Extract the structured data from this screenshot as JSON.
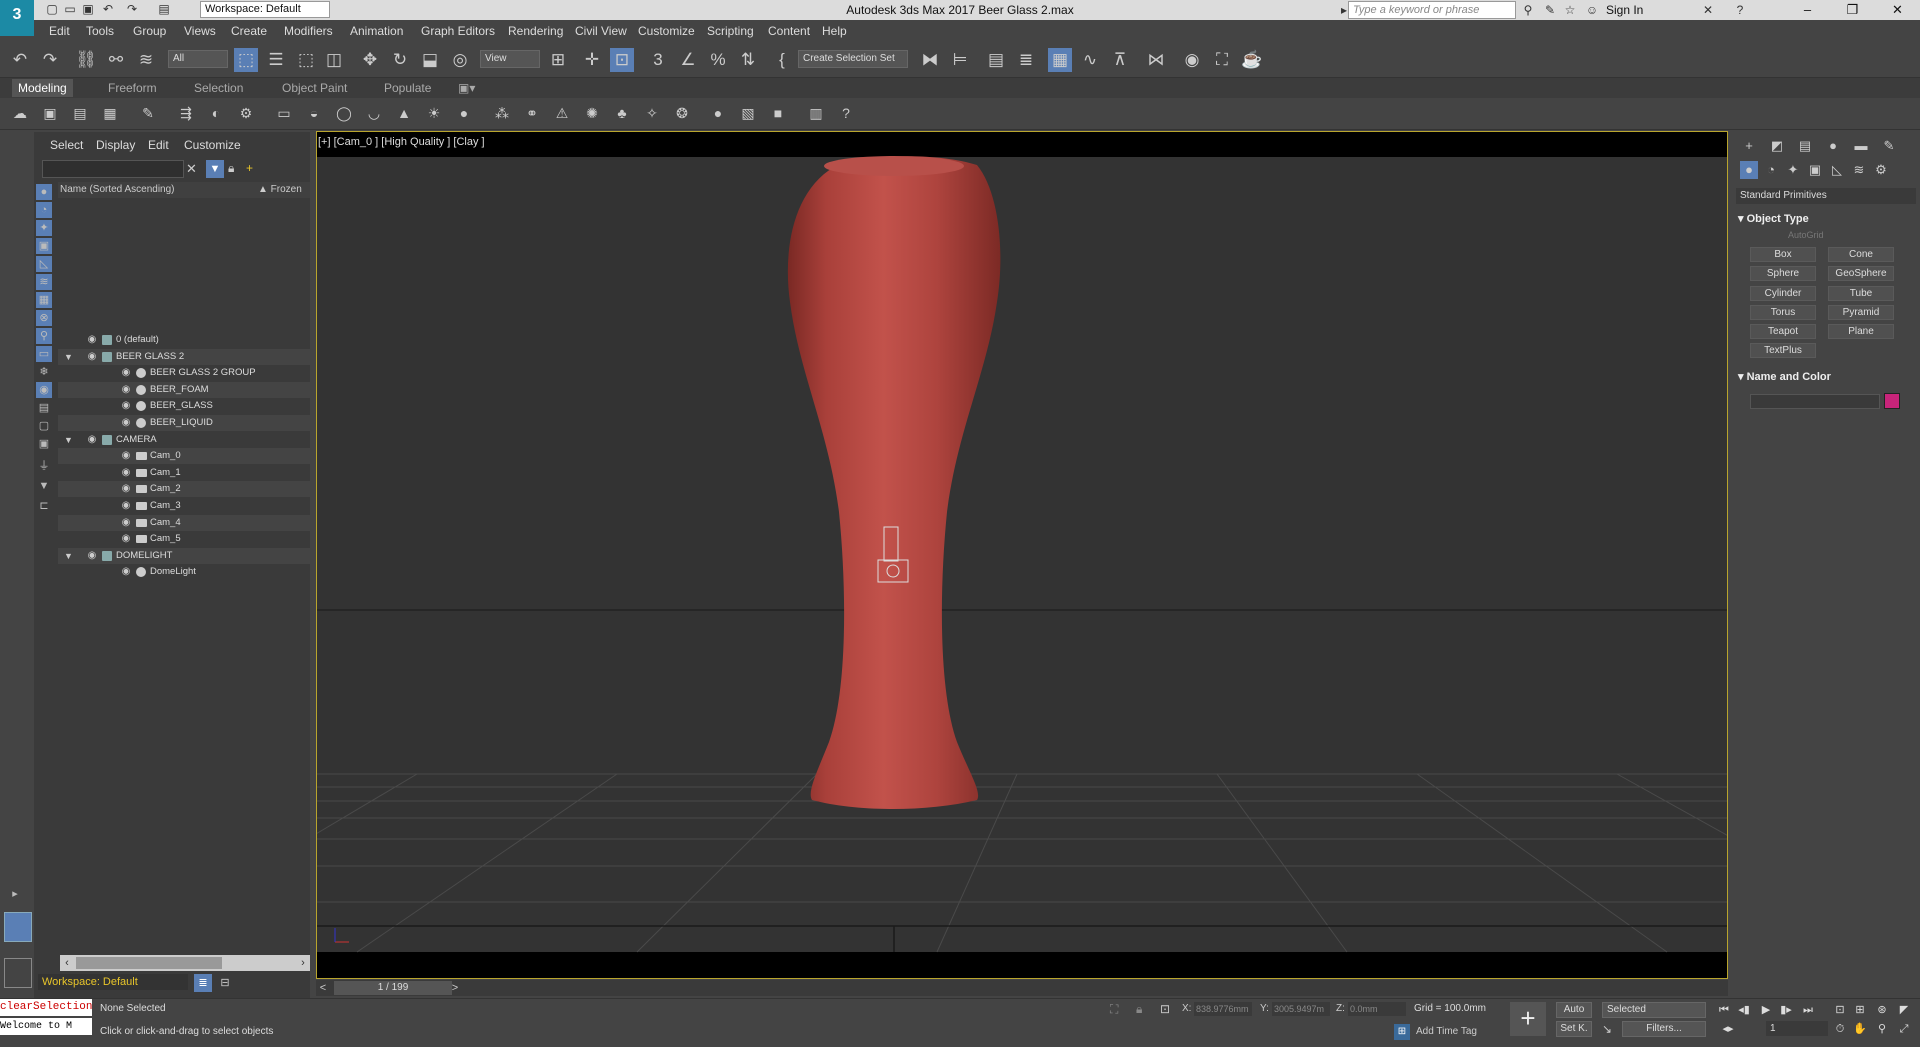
{
  "app": {
    "logo_text": "3",
    "title": "Autodesk 3ds Max 2017     Beer Glass 2.max",
    "workspace": "Workspace: Default",
    "search_placeholder": "Type a keyword or phrase",
    "sign_in": "Sign In"
  },
  "menu": [
    "Edit",
    "Tools",
    "Group",
    "Views",
    "Create",
    "Modifiers",
    "Animation",
    "Graph Editors",
    "Rendering",
    "Civil View",
    "Customize",
    "Scripting",
    "Content",
    "Help"
  ],
  "main_toolbar": {
    "selection_filter": "All",
    "reference_coord": "View",
    "selection_set": "Create Selection Set"
  },
  "ribbon_tabs": [
    {
      "label": "Modeling",
      "active": true
    },
    {
      "label": "Freeform",
      "active": false
    },
    {
      "label": "Selection",
      "active": false
    },
    {
      "label": "Object Paint",
      "active": false
    },
    {
      "label": "Populate",
      "active": false
    }
  ],
  "scene_explorer": {
    "menu": [
      "Select",
      "Display",
      "Edit",
      "Customize"
    ],
    "column_name": "Name (Sorted Ascending)",
    "column_frozen": "▲ Frozen",
    "rows": [
      {
        "label": "0 (default)",
        "indent": 0,
        "type": "layer",
        "expander": ""
      },
      {
        "label": "BEER GLASS 2",
        "indent": 0,
        "type": "layer",
        "expander": "▼"
      },
      {
        "label": "BEER GLASS 2 GROUP",
        "indent": 1,
        "type": "group",
        "expander": ""
      },
      {
        "label": "BEER_FOAM",
        "indent": 1,
        "type": "object",
        "expander": ""
      },
      {
        "label": "BEER_GLASS",
        "indent": 1,
        "type": "object",
        "expander": ""
      },
      {
        "label": "BEER_LIQUID",
        "indent": 1,
        "type": "object",
        "expander": ""
      },
      {
        "label": "CAMERA",
        "indent": 0,
        "type": "layer",
        "expander": "▼"
      },
      {
        "label": "Cam_0",
        "indent": 1,
        "type": "camera",
        "expander": ""
      },
      {
        "label": "Cam_1",
        "indent": 1,
        "type": "camera",
        "expander": ""
      },
      {
        "label": "Cam_2",
        "indent": 1,
        "type": "camera",
        "expander": ""
      },
      {
        "label": "Cam_3",
        "indent": 1,
        "type": "camera",
        "expander": ""
      },
      {
        "label": "Cam_4",
        "indent": 1,
        "type": "camera",
        "expander": ""
      },
      {
        "label": "Cam_5",
        "indent": 1,
        "type": "camera",
        "expander": ""
      },
      {
        "label": "DOMELIGHT",
        "indent": 0,
        "type": "layer",
        "expander": "▼"
      },
      {
        "label": "DomeLight",
        "indent": 1,
        "type": "light",
        "expander": ""
      }
    ],
    "workspace": "Workspace: Default"
  },
  "viewport": {
    "label": "[+] [Cam_0 ] [High Quality ] [Clay ]",
    "object_color": "#b0453e"
  },
  "timeline": {
    "frame_display": "1 / 199",
    "prev": "<",
    "next": ">"
  },
  "command_panel": {
    "category": "Standard Primitives",
    "rollout_object_type": "Object Type",
    "autogrid": "AutoGrid",
    "object_buttons": [
      "Box",
      "Cone",
      "Sphere",
      "GeoSphere",
      "Cylinder",
      "Tube",
      "Torus",
      "Pyramid",
      "Teapot",
      "Plane",
      "TextPlus"
    ],
    "rollout_name_color": "Name and Color",
    "object_color": "#c8247a"
  },
  "status": {
    "maxscript_line1": "clearSelection",
    "maxscript_line2": "Welcome to M",
    "selection": "None Selected",
    "prompt": "Click or click-and-drag to select objects",
    "x_label": "X:",
    "x_value": "838.9776mm",
    "y_label": "Y:",
    "y_value": "3005.9497m",
    "z_label": "Z:",
    "z_value": "0.0mm",
    "grid": "Grid = 100.0mm",
    "add_time_tag": "Add Time Tag",
    "auto_key": "Auto",
    "set_key": "Set K.",
    "key_filter": "Selected",
    "filters": "Filters...",
    "frame_value": "1"
  }
}
